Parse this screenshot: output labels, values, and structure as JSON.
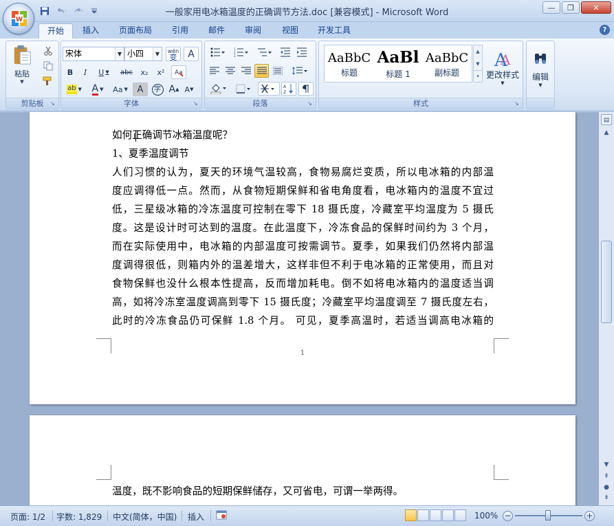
{
  "window": {
    "title": "一般家用电冰箱温度的正确调节方法.doc [兼容模式] - Microsoft Word",
    "minimize": "—",
    "restore": "❐",
    "close": "✕"
  },
  "ribbon_tabs": [
    "开始",
    "插入",
    "页面布局",
    "引用",
    "邮件",
    "审阅",
    "视图",
    "开发工具"
  ],
  "groups": {
    "clipboard": {
      "label": "剪贴板",
      "paste_label": "粘贴"
    },
    "font": {
      "label": "字体",
      "font_name": "宋体",
      "font_size": "小四",
      "wen": "wén",
      "wen_char": "变",
      "A_box": "A"
    },
    "paragraph": {
      "label": "段落"
    },
    "styles": {
      "label": "样式",
      "items": [
        {
          "sample": "AaBbC",
          "name": "标题"
        },
        {
          "sample": "AaBl",
          "name": "标题 1"
        },
        {
          "sample": "AaBbC",
          "name": "副标题"
        }
      ],
      "change_styles": "更改样式"
    },
    "editing": {
      "label": "编辑"
    }
  },
  "font_buttons": {
    "bold": "B",
    "italic": "I",
    "underline": "U",
    "strike": "abc",
    "sub": "x₂",
    "sup": "x²",
    "highlight": "ab",
    "color": "A",
    "case": "Aa",
    "shade": "A",
    "circle": "字",
    "grow": "A",
    "shrink": "A"
  },
  "document": {
    "page1_lines": [
      "如何正确调节冰箱温度呢？",
      "1、夏季温度调节",
      "人们习惯的认为，夏天的环境气温较高，食物易腐烂变质，所以电冰箱的内部温",
      "度应调得低一点。然而，从食物短期保鲜和省电角度看，电冰箱内的温度不宜过",
      "低，三星级冰箱的冷冻温度可控制在零下 18 摄氏度，冷藏室平均温度为 5 摄氏",
      "度。这是设计时可达到的温度。在此温度下，冷冻食品的保鲜时间约为 3 个月，",
      "而在实际使用中，电冰箱的内部温度可按需调节。夏季，如果我们仍然将内部温",
      "度调得很低，则箱内外的温差增大，这样非但不利于电冰箱的正常使用，而且对",
      "食物保鲜也没什么根本性提高，反而增加耗电。倒不如将电冰箱内的温度适当调",
      "高，如将冷冻室温度调高到零下 15 摄氏度；冷藏室平均温度调至 7 摄氏度左右，",
      "此时的冷冻食品仍可保鲜 1.8 个月。 可见，夏季高温时，若适当调高电冰箱的"
    ],
    "page_number": "1",
    "page2_lines": [
      "温度，既不影响食品的短期保鲜储存，又可省电，可谓一举两得。"
    ]
  },
  "statusbar": {
    "page": "页面: 1/2",
    "words": "字数: 1,829",
    "language": "中文(简体，中国)",
    "mode": "插入",
    "zoom": "100%",
    "zoom_level": 1.0
  }
}
